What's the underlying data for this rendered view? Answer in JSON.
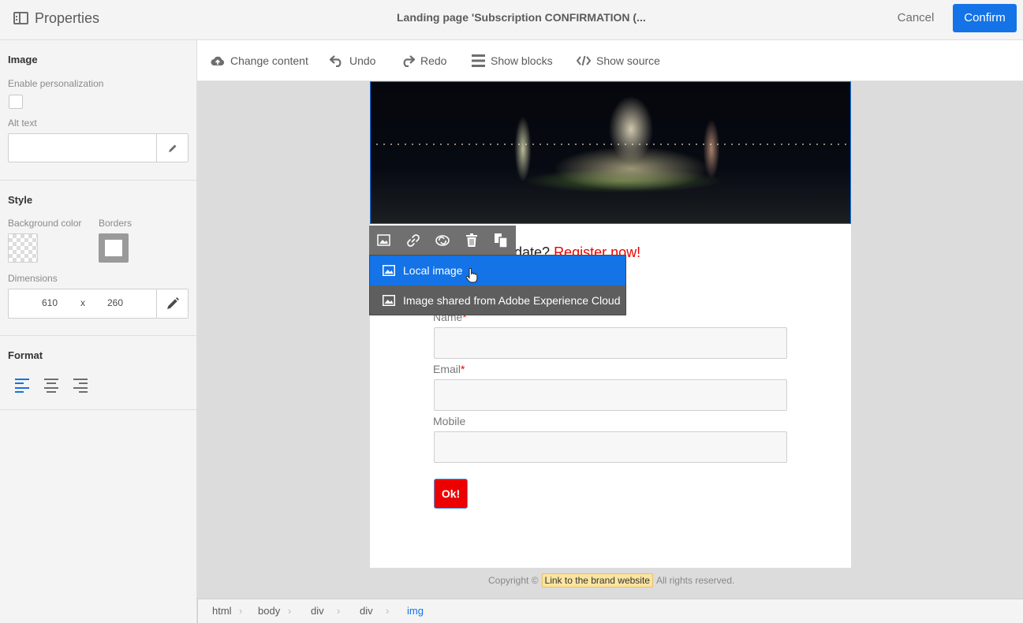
{
  "header": {
    "title": "Properties",
    "document_title": "Landing page 'Subscription CONFIRMATION (...",
    "cancel_label": "Cancel",
    "confirm_label": "Confirm"
  },
  "sidebar": {
    "image_section": {
      "title": "Image",
      "personalization_label": "Enable personalization",
      "alt_text_label": "Alt text",
      "alt_text_value": ""
    },
    "style_section": {
      "title": "Style",
      "background_color_label": "Background color",
      "borders_label": "Borders",
      "dimensions_label": "Dimensions",
      "width": "610",
      "height": "260",
      "separator": "x"
    },
    "format_section": {
      "title": "Format"
    }
  },
  "toolbar": {
    "change_content": "Change content",
    "undo": "Undo",
    "redo": "Redo",
    "show_blocks": "Show blocks",
    "show_source": "Show source"
  },
  "page": {
    "headline_visible": "date?",
    "headline_link": "Register now!",
    "fields": [
      {
        "label": "Name",
        "required": "*"
      },
      {
        "label": "Email",
        "required": "*"
      },
      {
        "label": "Mobile",
        "required": ""
      }
    ],
    "submit_label": "Ok!",
    "copyright_prefix": "Copyright ©",
    "brand_link": "Link to the brand website",
    "copyright_suffix": "All rights reserved."
  },
  "image_menu": {
    "items": [
      {
        "label": "Local image"
      },
      {
        "label": "Image shared from Adobe Experience Cloud"
      }
    ]
  },
  "breadcrumb": [
    "html",
    "body",
    "div",
    "div",
    "img"
  ],
  "colors": {
    "accent": "#1473e6",
    "error_red": "#e00000"
  }
}
